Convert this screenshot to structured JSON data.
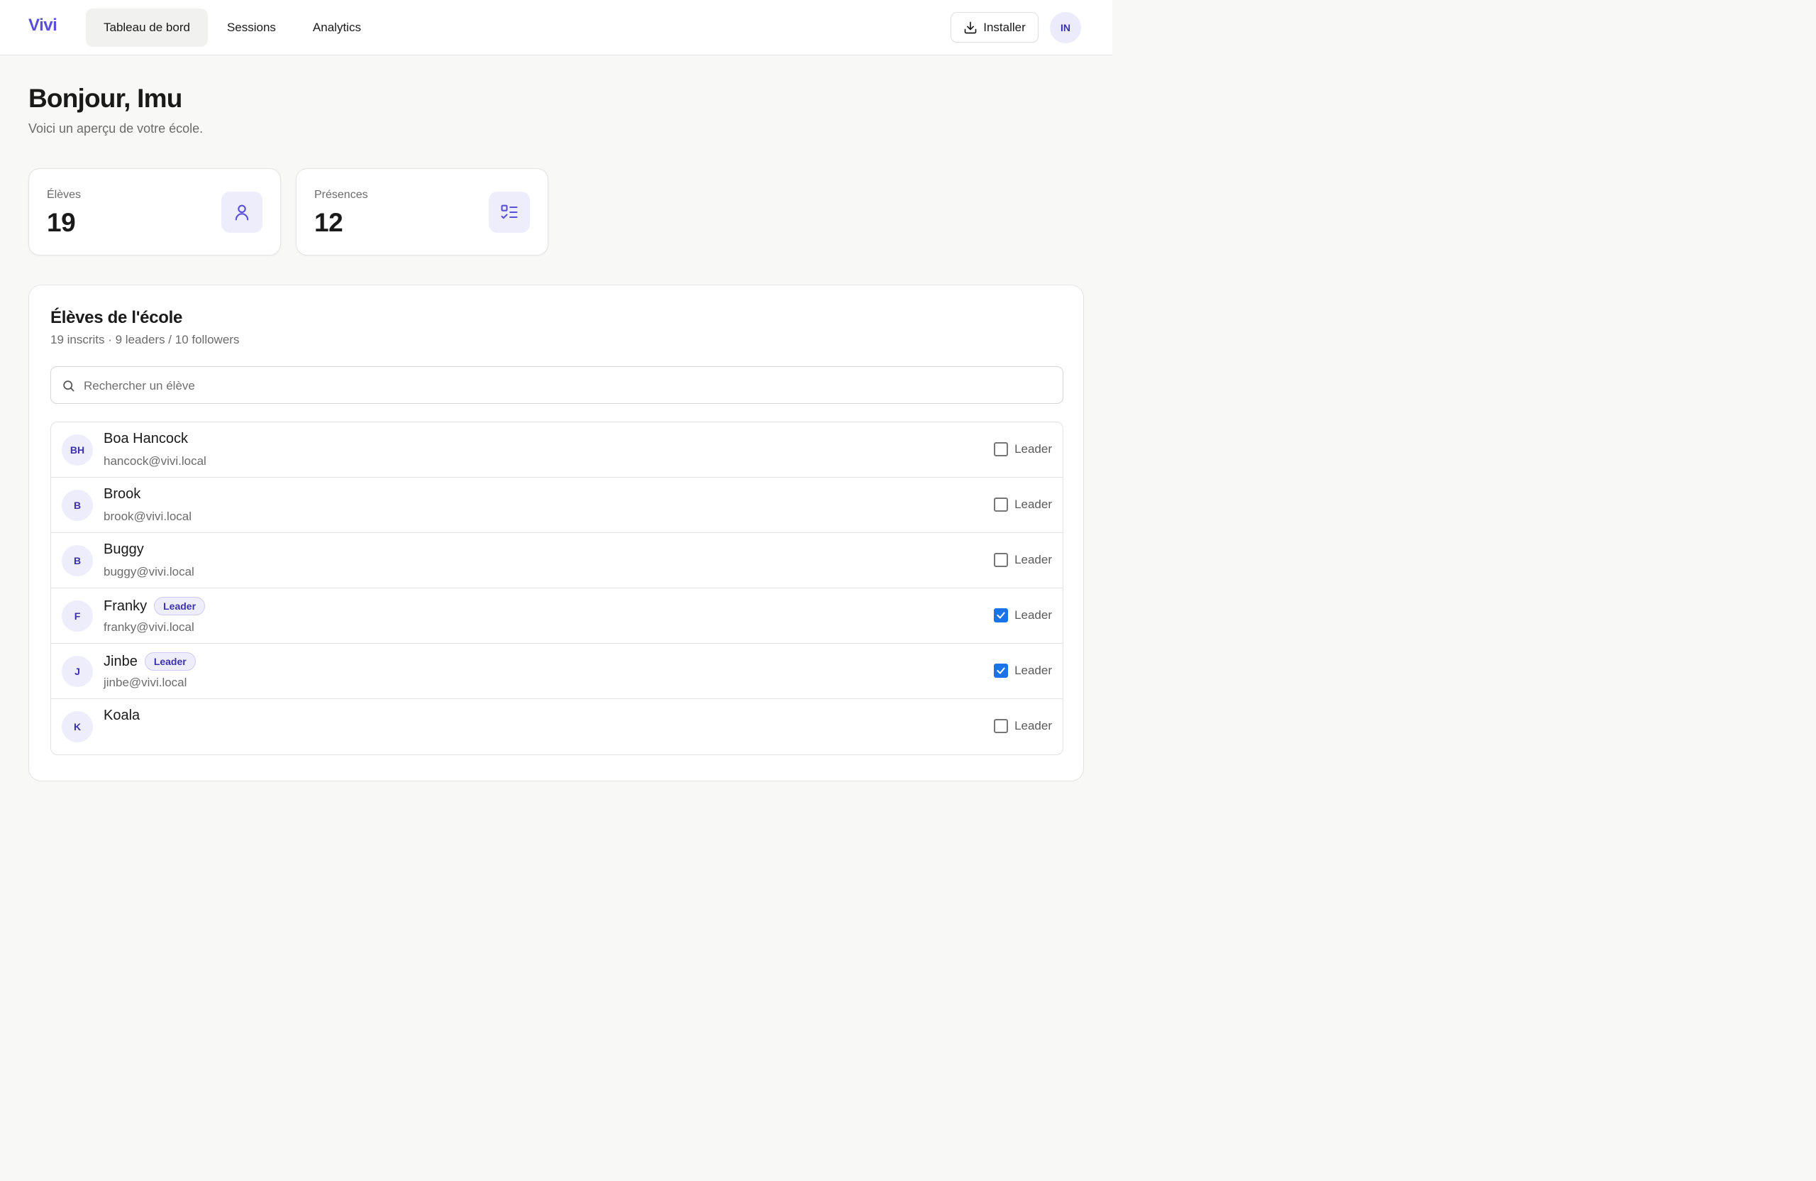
{
  "header": {
    "logo": "Vivi",
    "nav": [
      "Tableau de bord",
      "Sessions",
      "Analytics"
    ],
    "active_nav": "Tableau de bord",
    "install_label": "Installer",
    "user_initials": "IN"
  },
  "hero": {
    "greeting": "Bonjour, Imu",
    "subtitle": "Voici un aperçu de votre école."
  },
  "stats": [
    {
      "label": "Élèves",
      "value": "19",
      "icon": "user-icon"
    },
    {
      "label": "Présences",
      "value": "12",
      "icon": "checklist-icon"
    }
  ],
  "students_panel": {
    "title": "Élèves de l'école",
    "summary": "19 inscrits · 9 leaders / 10 followers",
    "search_placeholder": "Rechercher un élève",
    "toggle_label": "Leader",
    "badge_label": "Leader",
    "students": [
      {
        "initials": "BH",
        "name": "Boa Hancock",
        "email": "hancock@vivi.local",
        "leader": false
      },
      {
        "initials": "B",
        "name": "Brook",
        "email": "brook@vivi.local",
        "leader": false
      },
      {
        "initials": "B",
        "name": "Buggy",
        "email": "buggy@vivi.local",
        "leader": false
      },
      {
        "initials": "F",
        "name": "Franky",
        "email": "franky@vivi.local",
        "leader": true
      },
      {
        "initials": "J",
        "name": "Jinbe",
        "email": "jinbe@vivi.local",
        "leader": true
      },
      {
        "initials": "K",
        "name": "Koala",
        "email": "",
        "leader": false
      }
    ]
  },
  "colors": {
    "accent": "#5b4fd8",
    "checkbox_checked": "#1a73e8"
  }
}
